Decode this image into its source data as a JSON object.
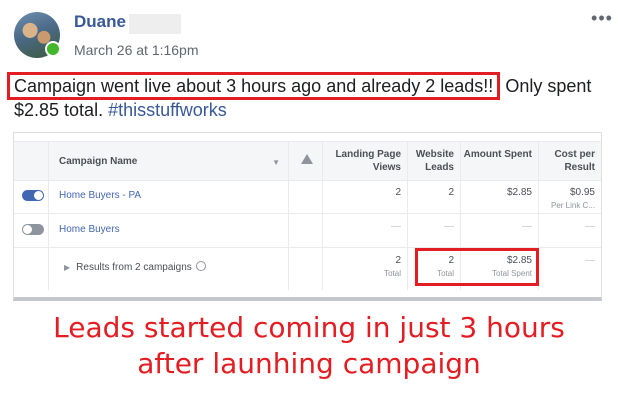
{
  "post": {
    "author": "Duane",
    "timestamp": "March 26 at 1:16pm",
    "text_highlight": "Campaign went live about 3 hours ago and already 2 leads!!",
    "text_rest": " Only spent $2.85 total. ",
    "hashtag": "#thisstuffworks",
    "more_icon": "more-options-icon"
  },
  "table": {
    "headers": {
      "name": "Campaign Name",
      "lpv": "Landing Page Views",
      "leads": "Website Leads",
      "amount": "Amount Spent",
      "cpr": "Cost per Result"
    },
    "rows": [
      {
        "name": "Home Buyers - PA",
        "toggle_on": true,
        "lpv": "2",
        "leads": "2",
        "amount": "$2.85",
        "cpr": "$0.95",
        "cpr_sub": "Per Link C..."
      },
      {
        "name": "Home Buyers",
        "toggle_on": false,
        "lpv": "—",
        "leads": "—",
        "amount": "—",
        "cpr": "—"
      }
    ],
    "summary": {
      "name": "Results from 2 campaigns",
      "lpv": "2",
      "lpv_sub": "Total",
      "leads": "2",
      "leads_sub": "Total",
      "amount": "$2.85",
      "amount_sub": "Total Spent",
      "cpr": "—"
    }
  },
  "caption": {
    "line1": "Leads started coming in just 3 hours",
    "line2": "after launhing campaign"
  },
  "colors": {
    "highlight_red": "#e41d23",
    "link_blue": "#385898",
    "toggle_on": "#4267b2",
    "online_green": "#42b72a"
  }
}
